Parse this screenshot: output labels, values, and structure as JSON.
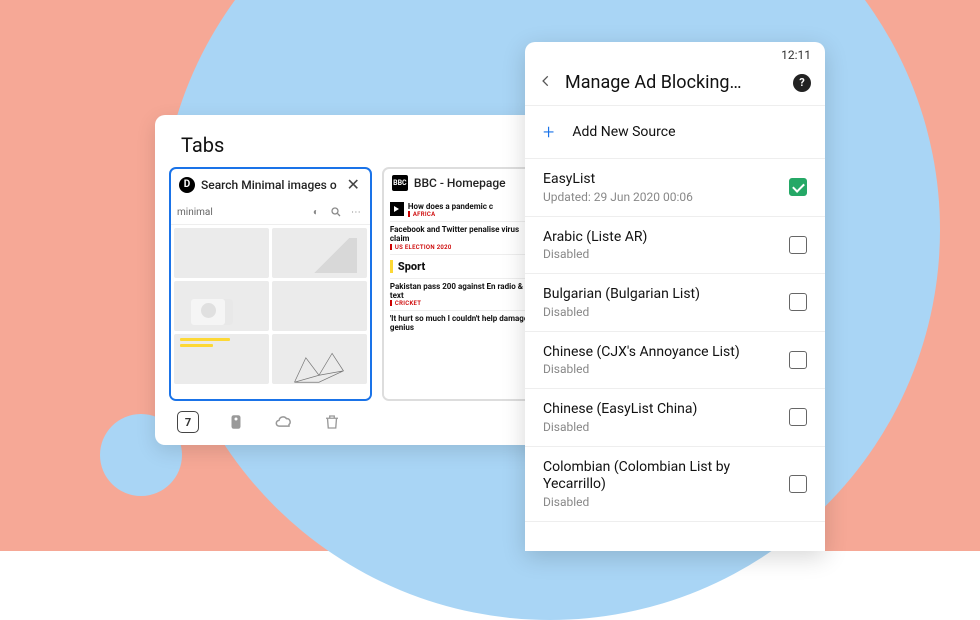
{
  "tabs_panel": {
    "title": "Tabs",
    "count": "7",
    "items": [
      {
        "favicon": "D",
        "title": "Search Minimal images o",
        "search_term": "minimal"
      },
      {
        "favicon": "BBC",
        "title": "BBC - Homepage",
        "news": [
          {
            "title": "How does a pandemic c",
            "tag": "AFRICA",
            "play": true
          },
          {
            "title": "Facebook and Twitter penalise virus claim",
            "tag": "US ELECTION 2020"
          }
        ],
        "sport_label": "Sport",
        "sport": [
          {
            "title": "Pakistan pass 200 against En radio & text",
            "tag": "CRICKET"
          },
          {
            "title": "'It hurt so much I couldn't help damaged genius"
          }
        ]
      }
    ]
  },
  "settings": {
    "time": "12:11",
    "title": "Manage Ad Blocking…",
    "add_label": "Add New Source",
    "sources": [
      {
        "name": "EasyList",
        "sub": "Updated: 29 Jun 2020 00:06",
        "enabled": true
      },
      {
        "name": "Arabic (Liste AR)",
        "sub": "Disabled",
        "enabled": false
      },
      {
        "name": "Bulgarian (Bulgarian List)",
        "sub": "Disabled",
        "enabled": false
      },
      {
        "name": "Chinese (CJX's Annoyance List)",
        "sub": "Disabled",
        "enabled": false
      },
      {
        "name": "Chinese (EasyList China)",
        "sub": "Disabled",
        "enabled": false
      },
      {
        "name": "Colombian (Colombian List by Yecarrillo)",
        "sub": "Disabled",
        "enabled": false
      }
    ]
  }
}
